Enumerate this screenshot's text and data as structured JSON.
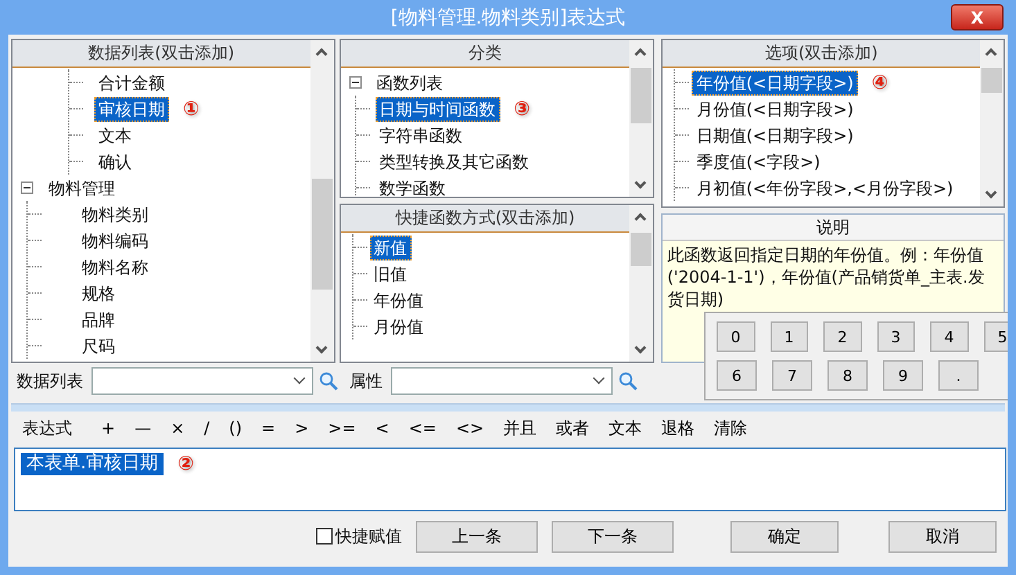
{
  "window": {
    "title": "[物料管理.物料类别]表达式",
    "close": "X"
  },
  "data_list": {
    "title": "数据列表(双击添加)",
    "leading_children": [
      {
        "label": "合计金额",
        "selected": false
      },
      {
        "label": "审核日期",
        "selected": true,
        "annotation": "①"
      },
      {
        "label": "文本",
        "selected": false
      },
      {
        "label": "确认",
        "selected": false
      }
    ],
    "nodes": [
      {
        "label": "物料管理",
        "expanded": true,
        "selected": false,
        "children": [
          {
            "label": "物料类别",
            "selected": false
          },
          {
            "label": "物料编码",
            "selected": false
          },
          {
            "label": "物料名称",
            "selected": false
          },
          {
            "label": "规格",
            "selected": false
          },
          {
            "label": "品牌",
            "selected": false
          },
          {
            "label": "尺码",
            "selected": false
          }
        ]
      }
    ]
  },
  "category": {
    "title": "分类",
    "nodes": [
      {
        "label": "函数列表",
        "expanded": true,
        "selected": false,
        "children": [
          {
            "label": "日期与时间函数",
            "selected": true,
            "annotation": "③"
          },
          {
            "label": "字符串函数",
            "selected": false
          },
          {
            "label": "类型转换及其它函数",
            "selected": false
          },
          {
            "label": "数学函数",
            "selected": false
          }
        ]
      }
    ]
  },
  "options": {
    "title": "选项(双击添加)",
    "items": [
      {
        "label": "年份值(<日期字段>)",
        "selected": true,
        "annotation": "④"
      },
      {
        "label": "月份值(<日期字段>)",
        "selected": false
      },
      {
        "label": "日期值(<日期字段>)",
        "selected": false
      },
      {
        "label": "季度值(<字段>)",
        "selected": false
      },
      {
        "label": "月初值(<年份字段>,<月份字段>)",
        "selected": false
      }
    ]
  },
  "quick_functions": {
    "title": "快捷函数方式(双击添加)",
    "items": [
      {
        "label": "新值",
        "selected": true
      },
      {
        "label": "旧值",
        "selected": false
      },
      {
        "label": "年份值",
        "selected": false
      },
      {
        "label": "月份值",
        "selected": false
      }
    ]
  },
  "description": {
    "title": "说明",
    "text": "此函数返回指定日期的年份值。例：年份值('2004-1-1')，年份值(产品销货单_主表.发货日期)"
  },
  "keypad": [
    [
      "0",
      "1",
      "2",
      "3",
      "4",
      "5"
    ],
    [
      "6",
      "7",
      "8",
      "9",
      "."
    ]
  ],
  "filters": [
    {
      "label": "数据列表"
    },
    {
      "label": "属性"
    }
  ],
  "toolbar": {
    "label": "表达式",
    "buttons": [
      "+",
      "—",
      "×",
      "/",
      "()",
      "=",
      ">",
      ">=",
      "<",
      "<=",
      "<>",
      "并且",
      "或者",
      "文本",
      "退格",
      "清除"
    ]
  },
  "expression": {
    "text": "本表单.审核日期",
    "selected": true,
    "annotation": "②"
  },
  "quick_assign": {
    "label": "快捷赋值",
    "checked": false
  },
  "nav_buttons": [
    "上一条",
    "下一条"
  ],
  "buttons": [
    "确定",
    "取消"
  ]
}
